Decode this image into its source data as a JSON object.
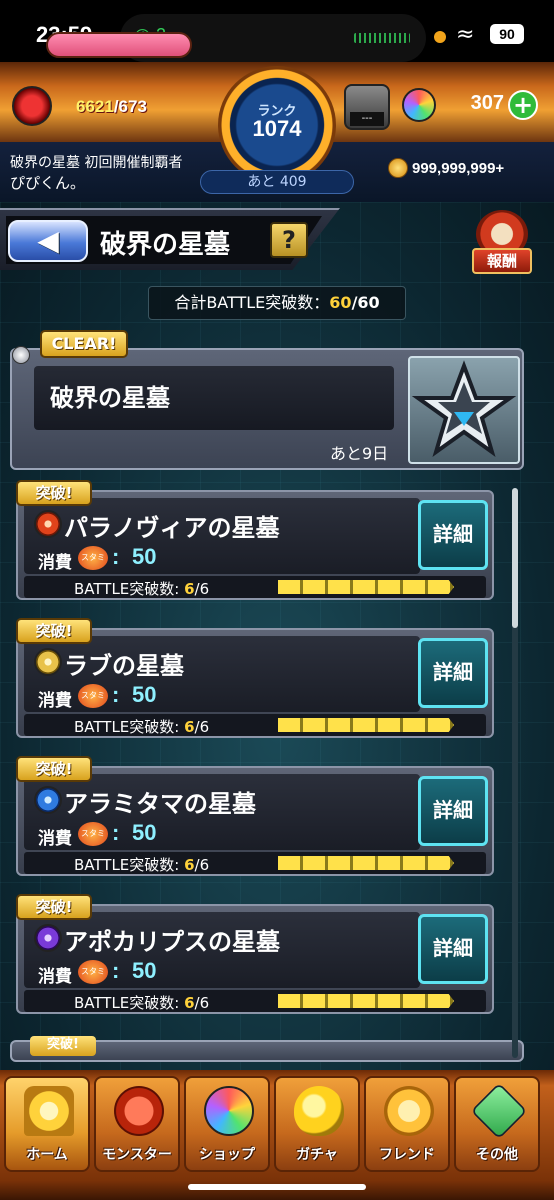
{
  "status": {
    "time": "23:59",
    "call": "2",
    "battery": "90"
  },
  "header": {
    "stamina_current": "6621",
    "stamina_max": "/673",
    "rank_label": "ランク",
    "rank_value": "1074",
    "rank_next": "あと 409",
    "item_box_value": "---",
    "orbs": "307",
    "title_text": "破界の星墓 初回開催制覇者",
    "username": "ぴぴくん。",
    "gold": "999,999,999+"
  },
  "page": {
    "title": "破界の星墓",
    "help": "?",
    "reward": "報酬",
    "total_label": "合計BATTLE突破数：",
    "total_current": "60",
    "total_max": "/60"
  },
  "clear_card": {
    "tag": "CLEAR!",
    "name": "破界の星墓",
    "remaining": "あと9日"
  },
  "quests": [
    {
      "tag": "突破!",
      "name": "パラノヴィアの星墓",
      "attr_color": "#e0431b",
      "cost_label": "消費",
      "cost_icon": "スタミナ",
      "cost_sep": ":",
      "cost": "50",
      "detail": "詳細",
      "battle_label": "BATTLE突破数: ",
      "battle_current": "6",
      "battle_max": "/6"
    },
    {
      "tag": "突破!",
      "name": "ラブの星墓",
      "attr_color": "#e8c24a",
      "cost_label": "消費",
      "cost_icon": "スタミナ",
      "cost_sep": ":",
      "cost": "50",
      "detail": "詳細",
      "battle_label": "BATTLE突破数: ",
      "battle_current": "6",
      "battle_max": "/6"
    },
    {
      "tag": "突破!",
      "name": "アラミタマの星墓",
      "attr_color": "#2f7be0",
      "cost_label": "消費",
      "cost_icon": "スタミナ",
      "cost_sep": ":",
      "cost": "50",
      "detail": "詳細",
      "battle_label": "BATTLE突破数: ",
      "battle_current": "6",
      "battle_max": "/6"
    },
    {
      "tag": "突破!",
      "name": "アポカリプスの星墓",
      "attr_color": "#7a3ad8",
      "cost_label": "消費",
      "cost_icon": "スタミナ",
      "cost_sep": ":",
      "cost": "50",
      "detail": "詳細",
      "battle_label": "BATTLE突破数: ",
      "battle_current": "6",
      "battle_max": "/6"
    }
  ],
  "peek_tag": "突破!",
  "nav": [
    {
      "label": "ホーム",
      "icon": "home-icon"
    },
    {
      "label": "モンスター",
      "icon": "monster-icon"
    },
    {
      "label": "ショップ",
      "icon": "orb-icon"
    },
    {
      "label": "ガチャ",
      "icon": "gacha-egg-icon"
    },
    {
      "label": "フレンド",
      "icon": "friends-icon"
    },
    {
      "label": "その他",
      "icon": "other-icon"
    }
  ]
}
